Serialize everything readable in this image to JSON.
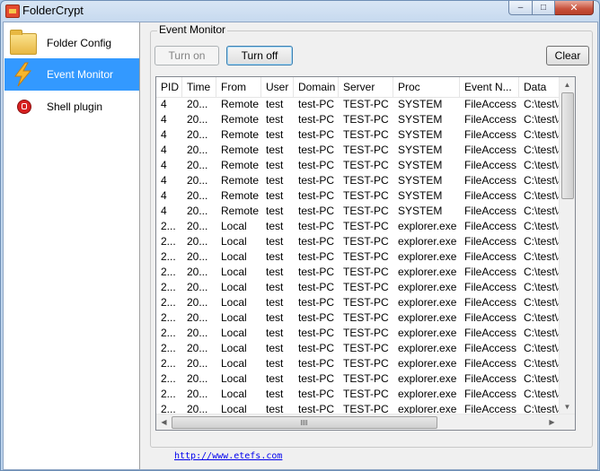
{
  "window": {
    "title": "FolderCrypt",
    "close_glyph": "✕",
    "maximize_glyph": "□",
    "minimize_glyph": "–"
  },
  "sidebar": {
    "items": [
      {
        "label": "Folder Config",
        "icon": "folder-icon"
      },
      {
        "label": "Event Monitor",
        "icon": "lightning-icon",
        "active": true
      },
      {
        "label": "Shell plugin",
        "icon": "lock-icon"
      }
    ]
  },
  "event_monitor": {
    "group_title": "Event Monitor",
    "turn_on_label": "Turn on",
    "turn_off_label": "Turn off",
    "clear_label": "Clear",
    "columns": [
      "PID",
      "Time",
      "From",
      "User",
      "Domain",
      "Server",
      "Proc",
      "Event N...",
      "Data"
    ],
    "rows": [
      [
        "4",
        "20...",
        "Remote",
        "test",
        "test-PC",
        "TEST-PC",
        "SYSTEM",
        "FileAccess",
        "C:\\test\\aaa"
      ],
      [
        "4",
        "20...",
        "Remote",
        "test",
        "test-PC",
        "TEST-PC",
        "SYSTEM",
        "FileAccess",
        "C:\\test\\aaa"
      ],
      [
        "4",
        "20...",
        "Remote",
        "test",
        "test-PC",
        "TEST-PC",
        "SYSTEM",
        "FileAccess",
        "C:\\test\\aaa"
      ],
      [
        "4",
        "20...",
        "Remote",
        "test",
        "test-PC",
        "TEST-PC",
        "SYSTEM",
        "FileAccess",
        "C:\\test\\aaa"
      ],
      [
        "4",
        "20...",
        "Remote",
        "test",
        "test-PC",
        "TEST-PC",
        "SYSTEM",
        "FileAccess",
        "C:\\test\\aaa"
      ],
      [
        "4",
        "20...",
        "Remote",
        "test",
        "test-PC",
        "TEST-PC",
        "SYSTEM",
        "FileAccess",
        "C:\\test\\aaa"
      ],
      [
        "4",
        "20...",
        "Remote",
        "test",
        "test-PC",
        "TEST-PC",
        "SYSTEM",
        "FileAccess",
        "C:\\test\\aaa"
      ],
      [
        "4",
        "20...",
        "Remote",
        "test",
        "test-PC",
        "TEST-PC",
        "SYSTEM",
        "FileAccess",
        "C:\\test\\aaa"
      ],
      [
        "2...",
        "20...",
        "Local",
        "test",
        "test-PC",
        "TEST-PC",
        "explorer.exe",
        "FileAccess",
        "C:\\test\\aaa"
      ],
      [
        "2...",
        "20...",
        "Local",
        "test",
        "test-PC",
        "TEST-PC",
        "explorer.exe",
        "FileAccess",
        "C:\\test\\aaa"
      ],
      [
        "2...",
        "20...",
        "Local",
        "test",
        "test-PC",
        "TEST-PC",
        "explorer.exe",
        "FileAccess",
        "C:\\test\\aaa"
      ],
      [
        "2...",
        "20...",
        "Local",
        "test",
        "test-PC",
        "TEST-PC",
        "explorer.exe",
        "FileAccess",
        "C:\\test\\aaa"
      ],
      [
        "2...",
        "20...",
        "Local",
        "test",
        "test-PC",
        "TEST-PC",
        "explorer.exe",
        "FileAccess",
        "C:\\test\\aaa"
      ],
      [
        "2...",
        "20...",
        "Local",
        "test",
        "test-PC",
        "TEST-PC",
        "explorer.exe",
        "FileAccess",
        "C:\\test\\aaa"
      ],
      [
        "2...",
        "20...",
        "Local",
        "test",
        "test-PC",
        "TEST-PC",
        "explorer.exe",
        "FileAccess",
        "C:\\test\\aaa"
      ],
      [
        "2...",
        "20...",
        "Local",
        "test",
        "test-PC",
        "TEST-PC",
        "explorer.exe",
        "FileAccess",
        "C:\\test\\aaa"
      ],
      [
        "2...",
        "20...",
        "Local",
        "test",
        "test-PC",
        "TEST-PC",
        "explorer.exe",
        "FileAccess",
        "C:\\test\\aaa"
      ],
      [
        "2...",
        "20...",
        "Local",
        "test",
        "test-PC",
        "TEST-PC",
        "explorer.exe",
        "FileAccess",
        "C:\\test\\aaa"
      ],
      [
        "2...",
        "20...",
        "Local",
        "test",
        "test-PC",
        "TEST-PC",
        "explorer.exe",
        "FileAccess",
        "C:\\test\\aaa"
      ],
      [
        "2...",
        "20...",
        "Local",
        "test",
        "test-PC",
        "TEST-PC",
        "explorer.exe",
        "FileAccess",
        "C:\\test\\aaa"
      ],
      [
        "2...",
        "20...",
        "Local",
        "test",
        "test-PC",
        "TEST-PC",
        "explorer.exe",
        "FileAccess",
        "C:\\test\\aaa"
      ]
    ]
  },
  "footer": {
    "link": "http://www.etefs.com"
  },
  "colors": {
    "accent": "#3399ff",
    "link": "#0000ee"
  }
}
